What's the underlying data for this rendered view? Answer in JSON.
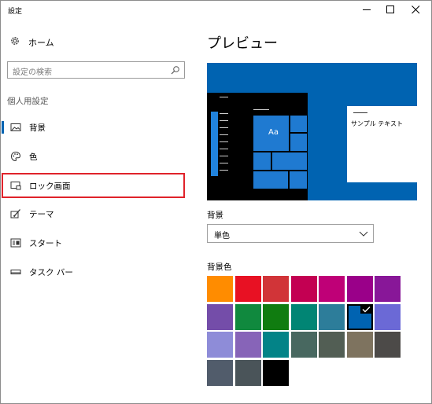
{
  "window": {
    "title": "設定"
  },
  "sidebar": {
    "home_label": "ホーム",
    "search_placeholder": "設定の検索",
    "section_title": "個人用設定",
    "items": [
      {
        "label": "背景",
        "icon": "picture-icon",
        "state": "current"
      },
      {
        "label": "色",
        "icon": "palette-icon"
      },
      {
        "label": "ロック画面",
        "icon": "lock-screen-icon",
        "state": "highlighted"
      },
      {
        "label": "テーマ",
        "icon": "theme-icon"
      },
      {
        "label": "スタート",
        "icon": "start-icon"
      },
      {
        "label": "タスク バー",
        "icon": "taskbar-icon"
      }
    ]
  },
  "main": {
    "title": "プレビュー",
    "preview": {
      "tile_text": "Aa",
      "sample_text": "サンプル テキスト"
    },
    "background_label": "背景",
    "background_value": "単色",
    "color_label": "背景色",
    "colors": [
      [
        "#ff8c00",
        "#e81123",
        "#d13438",
        "#c30052",
        "#bf0077",
        "#9a0089",
        "#881798"
      ],
      [
        "#744da9",
        "#10893e",
        "#107c10",
        "#018574",
        "#2d7d9a",
        "#0063b1",
        "#6b69d6"
      ],
      [
        "#8e8cd8",
        "#8764b8",
        "#038387",
        "#486860",
        "#525e54",
        "#7e735f",
        "#4c4a48"
      ],
      [
        "#515c6b",
        "#4a5459",
        "#000000"
      ]
    ],
    "selected_color": "#0063b1"
  },
  "colors": {
    "accent": "#0063b1",
    "highlight_box": "#e0222a"
  }
}
